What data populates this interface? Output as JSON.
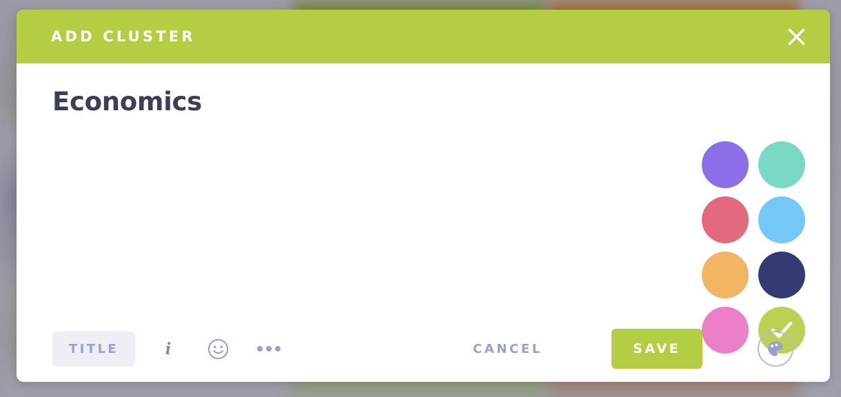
{
  "backdrop": {
    "description": "blurred-page-behind-modal"
  },
  "modal": {
    "header": {
      "title": "ADD CLUSTER",
      "background_color": "#b4ce44",
      "close_icon": "close-icon"
    },
    "body": {
      "cluster_name_value": "Economics",
      "cluster_name_placeholder": "Title",
      "color_grid": {
        "selected_index": 7,
        "check_icon": "check-icon",
        "swatches": [
          {
            "name": "purple",
            "hex": "#8b6fe8"
          },
          {
            "name": "teal",
            "hex": "#79d9c5"
          },
          {
            "name": "rose",
            "hex": "#e3697f"
          },
          {
            "name": "sky-blue",
            "hex": "#74c8f5"
          },
          {
            "name": "orange",
            "hex": "#f2b563"
          },
          {
            "name": "navy",
            "hex": "#343a72"
          },
          {
            "name": "pink",
            "hex": "#ed7fc8"
          },
          {
            "name": "green",
            "hex": "#bad156"
          }
        ]
      }
    },
    "footer": {
      "toolbar": {
        "title_style_label": "TITLE",
        "italic_label": "i",
        "emoji_icon": "smiley-face-icon",
        "more_icon": "ellipsis-icon"
      },
      "cancel_label": "CANCEL",
      "save_label": "SAVE",
      "save_color": "#b4ce44",
      "palette_icon": "palette-icon"
    }
  }
}
